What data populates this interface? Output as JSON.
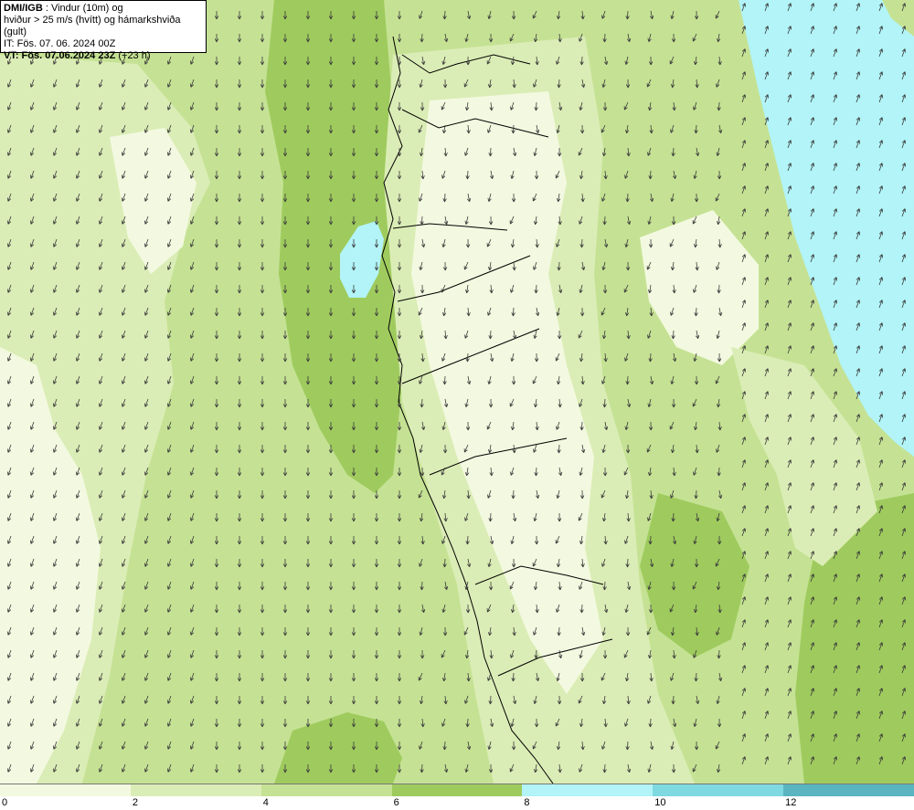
{
  "header": {
    "source": "DMI/IGB",
    "product": " : Vindur (10m) og",
    "line2": "hviður > 25 m/s (hvítt) og hámarkshviða (gult)",
    "issue_time": "IT: Fös. 07. 06. 2024 00Z",
    "valid_label": "VT: Fös. 07.06.2024 23Z",
    "lead_time": " (+23 h)"
  },
  "legend": {
    "colors": [
      "#f3f9e0",
      "#dbedb6",
      "#c5e294",
      "#9fcb5e",
      "#b2f4f7",
      "#7fd9e0",
      "#5ab5c1"
    ],
    "labels": [
      "0",
      "2",
      "4",
      "6",
      "8",
      "10",
      "12"
    ]
  },
  "map_colors": {
    "sea_base": "#c5e294",
    "calm": "#f3f9e0",
    "light": "#dbedb6",
    "moderate": "#9fcb5e",
    "strong": "#b2f4f7",
    "coastline": "#000000",
    "arrow": "#3a3a3a"
  }
}
